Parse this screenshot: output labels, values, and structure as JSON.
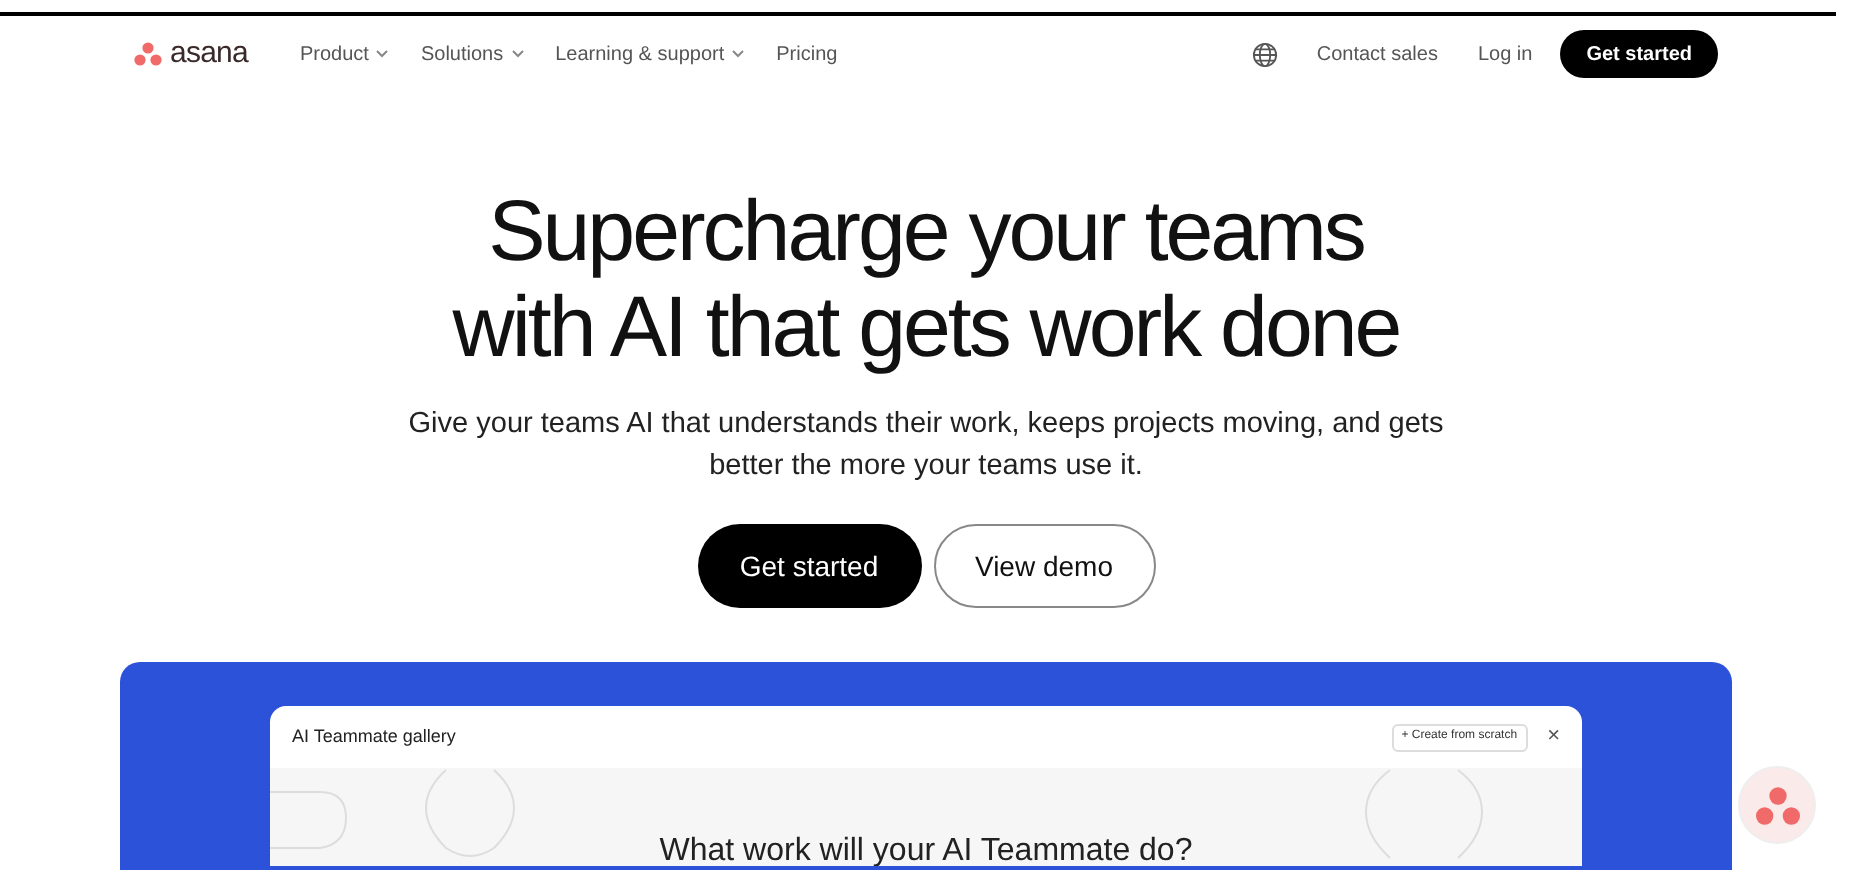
{
  "nav": {
    "brand": "asana",
    "menu": [
      {
        "label": "Product",
        "dropdown": true
      },
      {
        "label": "Solutions",
        "dropdown": true
      },
      {
        "label": "Learning & support",
        "dropdown": true
      },
      {
        "label": "Pricing",
        "dropdown": false
      }
    ],
    "contact": "Contact sales",
    "login": "Log in",
    "cta": "Get started"
  },
  "hero": {
    "title_lines": [
      "Supercharge your teams",
      "with AI that gets work done"
    ],
    "subtitle": "Give your teams AI that understands their work, keeps projects moving, and gets better the more your teams use it.",
    "primary": "Get started",
    "secondary": "View demo"
  },
  "gallery": {
    "title": "AI Teammate gallery",
    "create": "+ Create from scratch",
    "close": "×",
    "question": "What work will your AI Teammate do?"
  }
}
